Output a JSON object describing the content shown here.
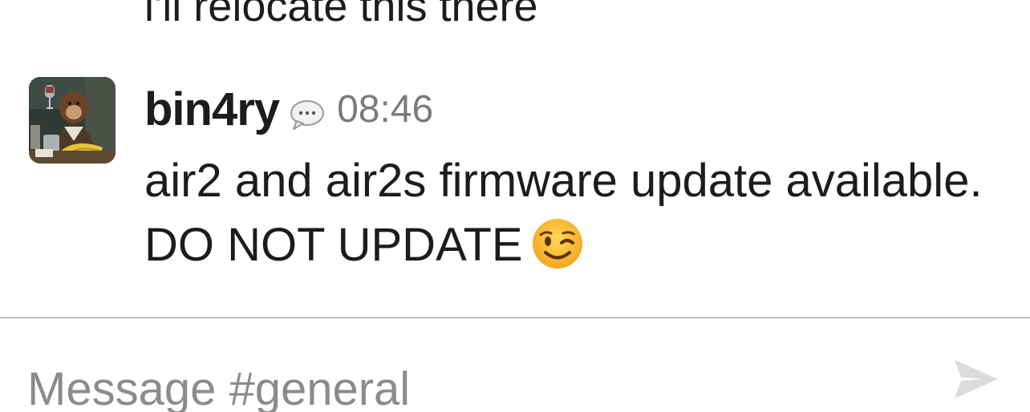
{
  "messages": [
    {
      "body": "i'll relocate this there"
    },
    {
      "author": "bin4ry",
      "timestamp": "08:46",
      "body": "air2 and air2s firmware update available. DO NOT UPDATE",
      "emoji": "winking-face"
    }
  ],
  "composer": {
    "placeholder": "Message #general",
    "value": ""
  },
  "colors": {
    "text": "#1d1c1d",
    "muted": "#7a7a7a",
    "placeholder": "#8b8b8b",
    "send_icon": "#dcdcdc",
    "emoji_face": "#f7c23c"
  },
  "icons": {
    "thread": "speech-bubble-icon",
    "send": "paper-plane-icon"
  }
}
